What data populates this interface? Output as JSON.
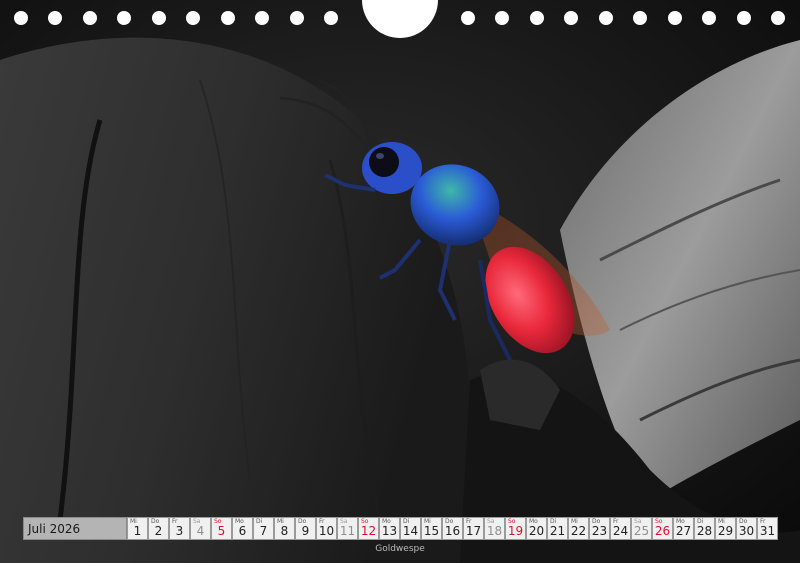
{
  "calendar": {
    "month_label": "Juli 2026",
    "days": [
      {
        "wd": "Mi",
        "num": "1",
        "type": "weekday"
      },
      {
        "wd": "Do",
        "num": "2",
        "type": "weekday"
      },
      {
        "wd": "Fr",
        "num": "3",
        "type": "weekday"
      },
      {
        "wd": "Sa",
        "num": "4",
        "type": "saturday"
      },
      {
        "wd": "So",
        "num": "5",
        "type": "sunday"
      },
      {
        "wd": "Mo",
        "num": "6",
        "type": "weekday"
      },
      {
        "wd": "Di",
        "num": "7",
        "type": "weekday"
      },
      {
        "wd": "Mi",
        "num": "8",
        "type": "weekday"
      },
      {
        "wd": "Do",
        "num": "9",
        "type": "weekday"
      },
      {
        "wd": "Fr",
        "num": "10",
        "type": "weekday"
      },
      {
        "wd": "Sa",
        "num": "11",
        "type": "saturday"
      },
      {
        "wd": "So",
        "num": "12",
        "type": "sunday"
      },
      {
        "wd": "Mo",
        "num": "13",
        "type": "weekday"
      },
      {
        "wd": "Di",
        "num": "14",
        "type": "weekday"
      },
      {
        "wd": "Mi",
        "num": "15",
        "type": "weekday"
      },
      {
        "wd": "Do",
        "num": "16",
        "type": "weekday"
      },
      {
        "wd": "Fr",
        "num": "17",
        "type": "weekday"
      },
      {
        "wd": "Sa",
        "num": "18",
        "type": "saturday"
      },
      {
        "wd": "So",
        "num": "19",
        "type": "sunday"
      },
      {
        "wd": "Mo",
        "num": "20",
        "type": "weekday"
      },
      {
        "wd": "Di",
        "num": "21",
        "type": "weekday"
      },
      {
        "wd": "Mi",
        "num": "22",
        "type": "weekday"
      },
      {
        "wd": "Do",
        "num": "23",
        "type": "weekday"
      },
      {
        "wd": "Fr",
        "num": "24",
        "type": "weekday"
      },
      {
        "wd": "Sa",
        "num": "25",
        "type": "saturday"
      },
      {
        "wd": "So",
        "num": "26",
        "type": "sunday"
      },
      {
        "wd": "Mo",
        "num": "27",
        "type": "weekday"
      },
      {
        "wd": "Di",
        "num": "28",
        "type": "weekday"
      },
      {
        "wd": "Mi",
        "num": "29",
        "type": "weekday"
      },
      {
        "wd": "Do",
        "num": "30",
        "type": "weekday"
      },
      {
        "wd": "Fr",
        "num": "31",
        "type": "weekday"
      }
    ]
  },
  "caption": "Goldwespe",
  "colors": {
    "sunday": "#e0102a",
    "wasp_head": "#2a5bd6",
    "wasp_abdomen": "#e8283a"
  }
}
